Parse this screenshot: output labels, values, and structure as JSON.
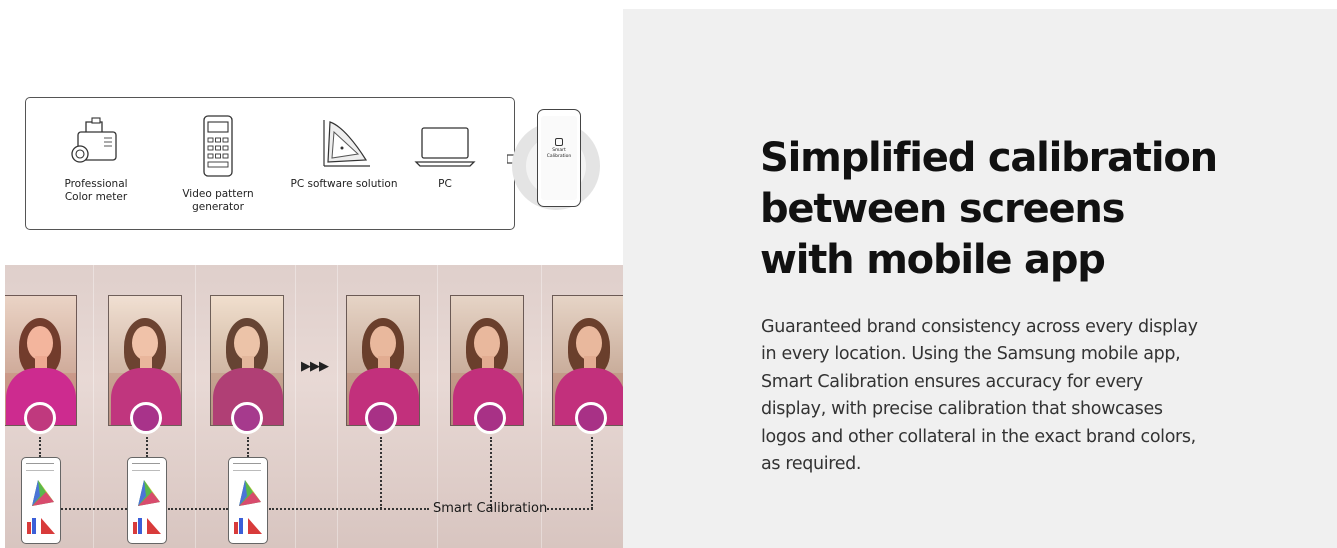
{
  "workflow": {
    "tools": [
      {
        "label": "Professional\nColor meter",
        "icon": "color-meter-icon"
      },
      {
        "label": "Video pattern generator",
        "icon": "pattern-generator-icon"
      },
      {
        "label": "PC software solution",
        "icon": "gamut-software-icon"
      },
      {
        "label": "PC",
        "icon": "laptop-icon"
      }
    ],
    "phone_app_label": "Smart\nCalibration"
  },
  "scene": {
    "smart_calibration_label": "Smart Calibration",
    "swatch_colors": [
      "#c0397e",
      "#a8338a",
      "#a63a8d",
      "#a83186",
      "#a83186",
      "#a83186"
    ]
  },
  "content": {
    "headline_lines": [
      "Simplified calibration",
      "between screens",
      "with mobile app"
    ],
    "body_lines": [
      "Guaranteed brand consistency across every display",
      "in every location. Using the Samsung mobile app,",
      "Smart Calibration ensures accuracy for every",
      "display, with precise calibration that showcases",
      "logos and other collateral in the exact brand colors,",
      "as required."
    ]
  },
  "colors": {
    "right_panel_bg": "#f0f0f0",
    "headline": "#111111",
    "body": "#333333"
  }
}
